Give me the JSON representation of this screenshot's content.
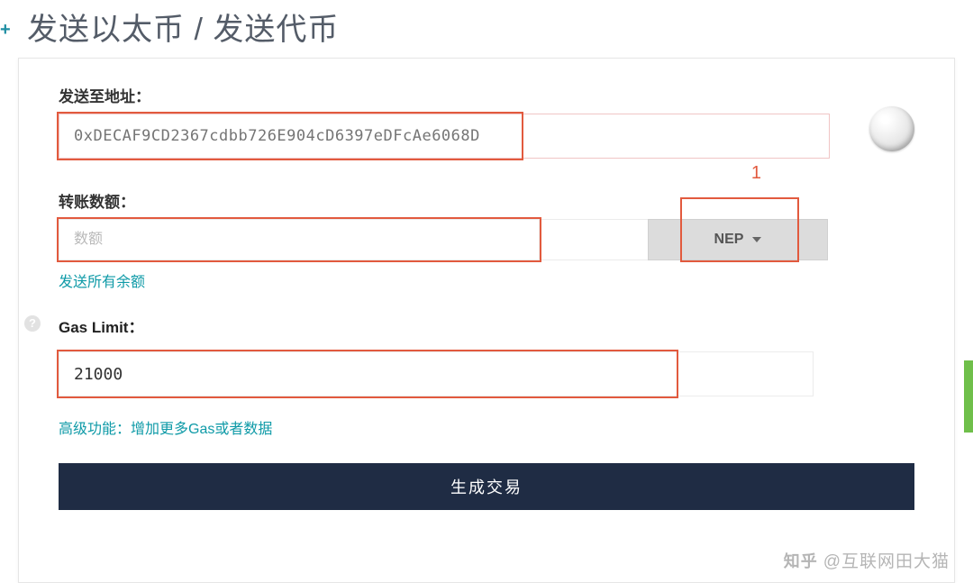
{
  "header": {
    "title": "发送以太币 / 发送代币"
  },
  "form": {
    "address": {
      "label": "发送至地址：",
      "placeholder": "0xDECAF9CD2367cdbb726E904cD6397eDFcAe6068D",
      "value": ""
    },
    "amount": {
      "label": "转账数额：",
      "placeholder": "数额",
      "value": "",
      "token_selected": "NEP",
      "send_all_link": "发送所有余额"
    },
    "gas": {
      "label": "Gas Limit：",
      "value": "21000"
    },
    "advanced_link": "高级功能：增加更多Gas或者数据",
    "generate_button": "生成交易"
  },
  "annotations": {
    "marker1": "1"
  },
  "watermark": {
    "brand": "知乎",
    "author": "@互联网田大猫"
  }
}
